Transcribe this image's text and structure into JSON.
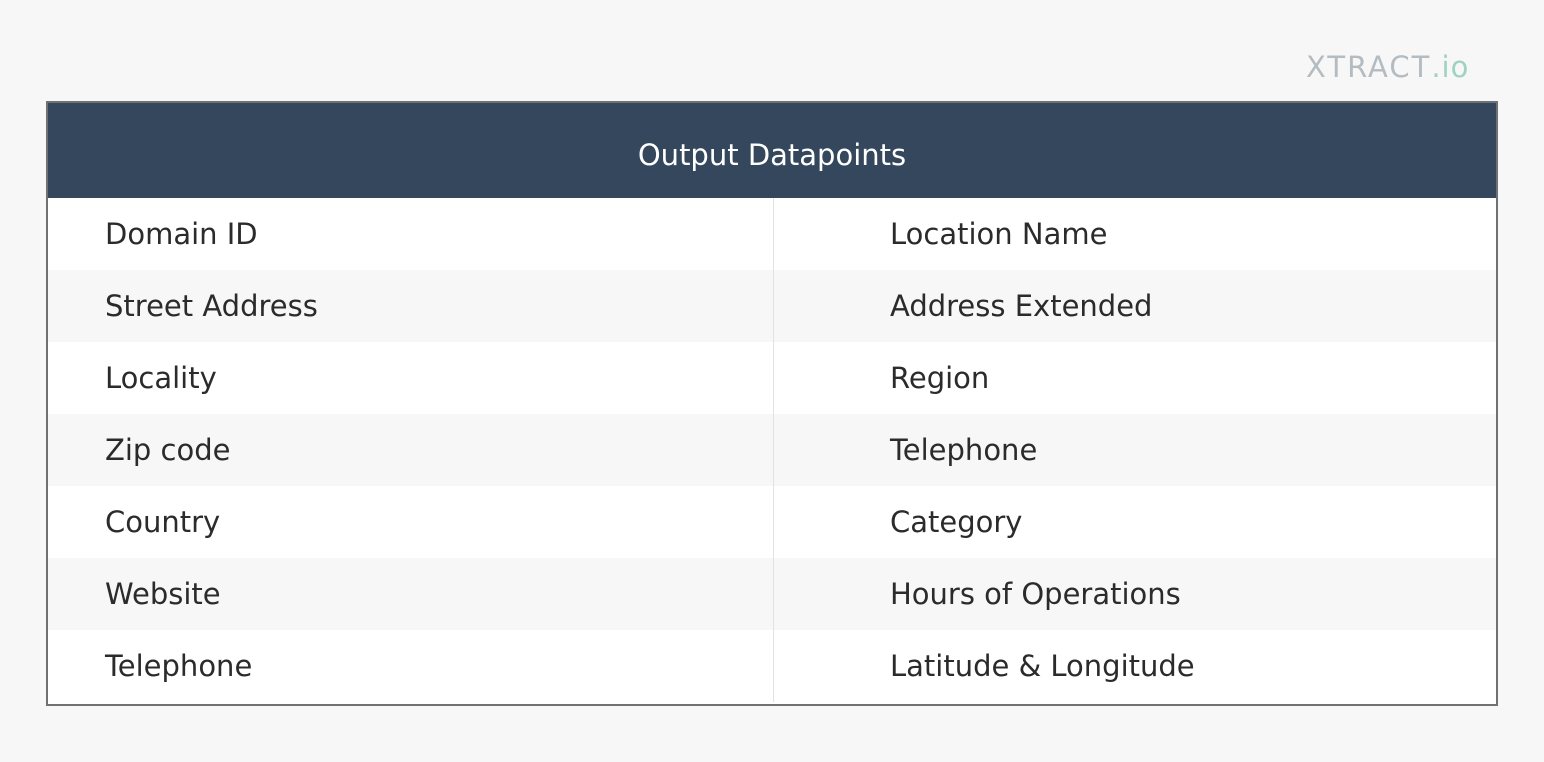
{
  "logo": {
    "main": "XTRACT",
    "suffix": ".io"
  },
  "colors": {
    "header_bg": "#34475c",
    "logo_gray": "#b4bcc2",
    "logo_accent": "#9fd3bf",
    "border": "#6f7275"
  },
  "table": {
    "title": "Output Datapoints",
    "rows": [
      {
        "left": "Domain ID",
        "right": "Location Name"
      },
      {
        "left": "Street Address",
        "right": "Address Extended"
      },
      {
        "left": "Locality",
        "right": "Region"
      },
      {
        "left": "Zip code",
        "right": "Telephone"
      },
      {
        "left": "Country",
        "right": "Category"
      },
      {
        "left": "Website",
        "right": "Hours of Operations"
      },
      {
        "left": "Telephone",
        "right": "Latitude & Longitude"
      }
    ]
  }
}
